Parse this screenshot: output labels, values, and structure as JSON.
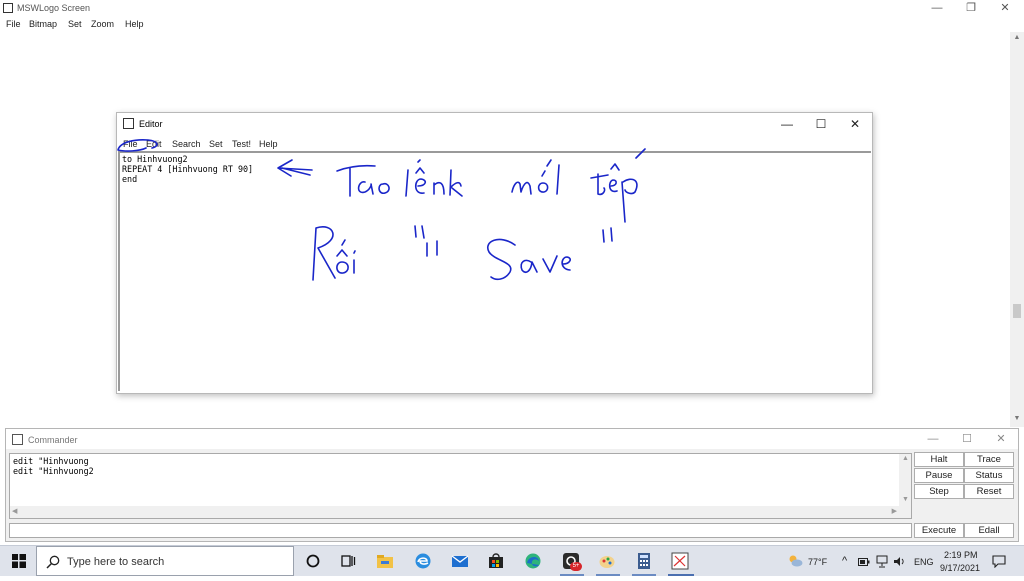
{
  "main_window": {
    "title": "MSWLogo Screen",
    "menu": [
      "File",
      "Bitmap",
      "Set",
      "Zoom",
      "Help"
    ],
    "controls": {
      "minimize": "—",
      "restore": "❐",
      "close": "✕"
    }
  },
  "editor": {
    "title": "Editor",
    "menu": [
      "File",
      "Edit",
      "Search",
      "Set",
      "Test!",
      "Help"
    ],
    "controls": {
      "minimize": "—",
      "maximize": "☐",
      "close": "✕"
    },
    "code_lines": [
      "to Hinhvuong2",
      "REPEAT 4 [Hinhvuong RT 90]",
      "end"
    ]
  },
  "annotation": {
    "color": "#1a26c9"
  },
  "commander": {
    "title": "Commander",
    "controls": {
      "minimize": "—",
      "maximize": "☐",
      "close": "✕"
    },
    "history": [
      "edit \"Hinhvuong",
      "edit \"Hinhvuong2"
    ],
    "input_value": "",
    "buttons": {
      "halt": "Halt",
      "trace": "Trace",
      "pause": "Pause",
      "status": "Status",
      "step": "Step",
      "reset": "Reset",
      "execute": "Execute",
      "edall": "Edall"
    }
  },
  "taskbar": {
    "search_placeholder": "Type here to search",
    "weather": "77°F",
    "language": "ENG",
    "time": "2:19 PM",
    "date": "9/17/2021",
    "badge": "5+"
  },
  "colors": {
    "annotation_ink": "#1a26c9",
    "taskbar_bg": "#dfe3eb"
  }
}
